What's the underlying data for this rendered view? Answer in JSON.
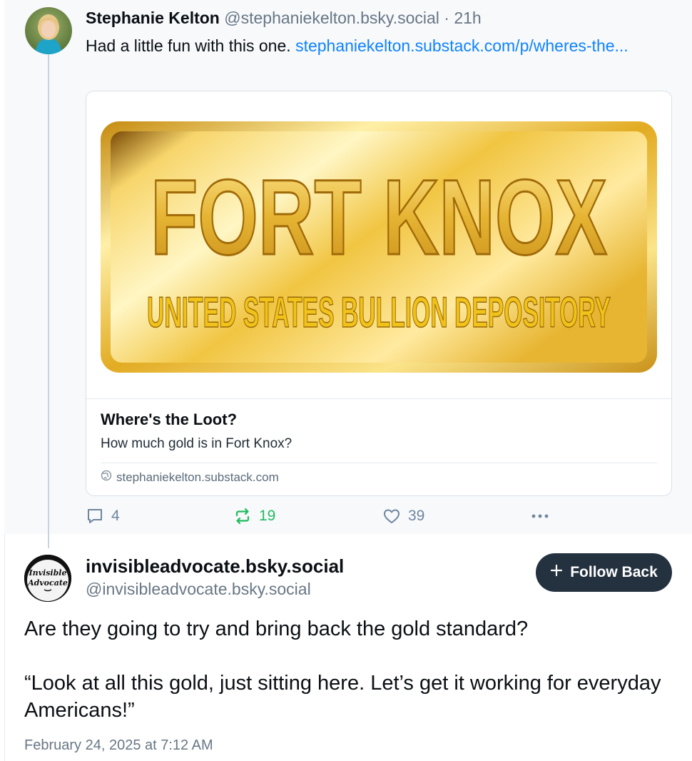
{
  "parent_post": {
    "author_name": "Stephanie Kelton",
    "author_handle": "@stephaniekelton.bsky.social",
    "time_ago": "21h",
    "text": "Had a little fun with this one. ",
    "link_text": "stephaniekelton.substack.com/p/wheres-the...",
    "card": {
      "image_title": "FORT KNOX",
      "image_subtitle": "UNITED STATES BULLION DEPOSITORY",
      "title": "Where's the Loot?",
      "description": "How much gold is in Fort Knox?",
      "domain": "stephaniekelton.substack.com"
    },
    "actions": {
      "replies": "4",
      "reposts": "19",
      "likes": "39"
    }
  },
  "reply_post": {
    "avatar_text_line1": "Invisible",
    "avatar_text_line2": "Advocate",
    "display_name": "invisibleadvocate.bsky.social",
    "handle": "@invisibleadvocate.bsky.social",
    "follow_label": "Follow Back",
    "body_line1": "Are they going to try and bring back the gold standard?",
    "body_line2": "“Look at all this gold, just sitting here. Let’s get it working for everyday Americans!”",
    "timestamp": "February 24, 2025 at 7:12 AM"
  },
  "colors": {
    "link": "#1083fe",
    "repost_active": "#20bc5e",
    "follow_button_bg": "#24313f",
    "muted": "#687785",
    "gold": "#e5b52a"
  }
}
